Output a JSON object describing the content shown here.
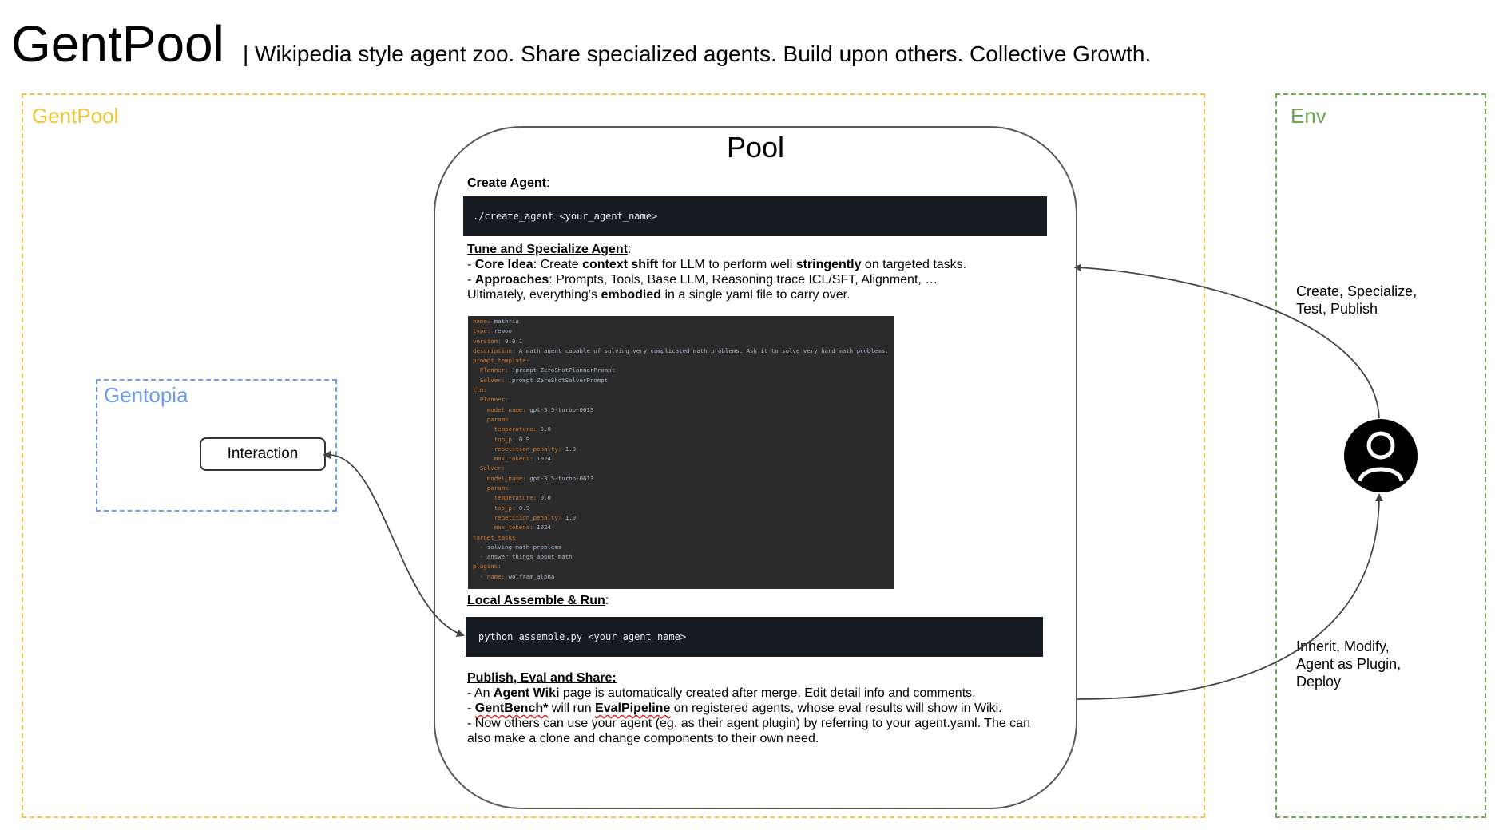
{
  "header": {
    "title": "GentPool",
    "subtitle": "| Wikipedia style agent zoo. Share specialized agents. Build upon others. Collective Growth."
  },
  "regions": {
    "gentpool_label": "GentPool",
    "env_label": "Env",
    "gentopia_label": "Gentopia"
  },
  "interaction_button": "Interaction",
  "pool": {
    "title": "Pool",
    "create_heading": "Create Agent",
    "create_code": "./create_agent <your_agent_name>",
    "tune_heading": "Tune and Specialize Agent",
    "tune_line1": {
      "a": "- ",
      "b": "Core Idea",
      "c": ": Create ",
      "d": "context shift",
      "e": " for LLM to perform well ",
      "f": "stringently",
      "g": " on targeted tasks."
    },
    "tune_line2": {
      "a": "- ",
      "b": "Approaches",
      "c": ": Prompts, Tools, Base LLM, Reasoning trace ICL/SFT, Alignment, …"
    },
    "tune_line3": {
      "a": "Ultimately, everything’s ",
      "b": "embodied",
      "c": " in a single yaml file to carry over."
    },
    "yaml_lines": [
      {
        "k": "name: ",
        "v": "mathria"
      },
      {
        "k": "type: ",
        "v": "rewoo"
      },
      {
        "k": "version: ",
        "v": "0.0.1"
      },
      {
        "k": "description: ",
        "v": "A math agent capable of solving very complicated math problems. Ask it to solve very hard math problems."
      },
      {
        "k": "prompt_template:",
        "v": ""
      },
      {
        "k": "  Planner: ",
        "v": "!prompt ZeroShotPlannerPrompt"
      },
      {
        "k": "  Solver: ",
        "v": "!prompt ZeroShotSolverPrompt"
      },
      {
        "k": "llm:",
        "v": ""
      },
      {
        "k": "  Planner:",
        "v": ""
      },
      {
        "k": "    model_name: ",
        "v": "gpt-3.5-turbo-0613"
      },
      {
        "k": "    params:",
        "v": ""
      },
      {
        "k": "      temperature: ",
        "v": "0.0"
      },
      {
        "k": "      top_p: ",
        "v": "0.9"
      },
      {
        "k": "      repetition_penalty: ",
        "v": "1.0"
      },
      {
        "k": "      max_tokens: ",
        "v": "1024"
      },
      {
        "k": "  Solver:",
        "v": ""
      },
      {
        "k": "    model_name: ",
        "v": "gpt-3.5-turbo-0613"
      },
      {
        "k": "    params:",
        "v": ""
      },
      {
        "k": "      temperature: ",
        "v": "0.0"
      },
      {
        "k": "      top_p: ",
        "v": "0.9"
      },
      {
        "k": "      repetition_penalty: ",
        "v": "1.0"
      },
      {
        "k": "      max_tokens: ",
        "v": "1024"
      },
      {
        "k": "target_tasks:",
        "v": ""
      },
      {
        "k": "  - ",
        "v": "solving math problems"
      },
      {
        "k": "  - ",
        "v": "answer things about math"
      },
      {
        "k": "plugins:",
        "v": ""
      },
      {
        "k": "  - name: ",
        "v": "wolfram_alpha"
      }
    ],
    "local_heading": "Local Assemble & Run",
    "local_code": "python assemble.py <your_agent_name>",
    "publish_heading": "Publish, Eval and Share:",
    "pub_line1": {
      "a": "- An ",
      "b": "Agent Wiki",
      "c": " page is automatically created after merge. Edit detail info and comments."
    },
    "pub_line2": {
      "a": "- ",
      "b": "GentBench*",
      "c": " will run ",
      "d": "EvalPipeline",
      "e": " on registered agents, whose eval results will show in Wiki."
    },
    "pub_line3": "- Now others can use your agent (eg. as their agent plugin) by referring to your agent.yaml. The can",
    "pub_line4": "also make a clone and change components to their own need."
  },
  "env": {
    "create_text": [
      "Create, Specialize,",
      "Test, Publish"
    ],
    "inherit_text": [
      "Inherit, Modify,",
      "Agent as Plugin,",
      "Deploy"
    ]
  },
  "colors": {
    "gentpool": "#F1C232",
    "env": "#6AA84F",
    "gentopia": "#6D9EEB",
    "code_bg": "#161b22",
    "yaml_bg": "#2b2b2b"
  }
}
